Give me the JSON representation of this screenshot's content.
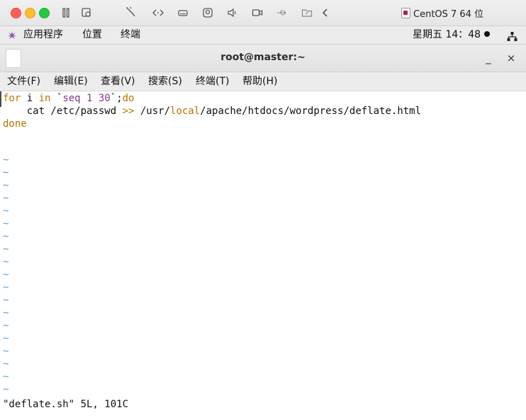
{
  "host_toolbar": {
    "vm_name": "CentOS 7 64 位",
    "icons": [
      "pause-icon",
      "snapshot-icon",
      "wrench-icon",
      "code-arrows-icon",
      "disk-icon",
      "camera-icon",
      "audio-icon",
      "video-icon",
      "usb-icon",
      "folder-share-icon",
      "chevron-left-icon"
    ]
  },
  "gnome_panel": {
    "applications": "应用程序",
    "places": "位置",
    "terminal": "终端",
    "clock": "星期五 14：48",
    "network_icon": "network-icon"
  },
  "terminal_window": {
    "title": "root@master:~",
    "minimize": "_",
    "close": "×"
  },
  "menubar": {
    "items": [
      "文件(F)",
      "编辑(E)",
      "查看(V)",
      "搜索(S)",
      "终端(T)",
      "帮助(H)"
    ]
  },
  "editor": {
    "line1": {
      "kw_for": "for",
      "var": " i ",
      "kw_in": "in",
      "sp": " `",
      "seq": "seq",
      "n1": " 1 ",
      "n2": "30",
      "tail": "`;",
      "kw_do": "do"
    },
    "line2": {
      "pre": "    cat /etc/passwd ",
      "redir": ">>",
      "path1": " /usr/",
      "local": "local",
      "path2": "/apache/htdocs/wordpress/deflate.html"
    },
    "line3": {
      "kw_done": "done"
    },
    "empty_line_marker": "~",
    "status": "\"deflate.sh\" 5L, 101C"
  },
  "colors": {
    "keyword": "#b87400",
    "number": "#7d3b8b",
    "tilde": "#5aa1d6"
  }
}
